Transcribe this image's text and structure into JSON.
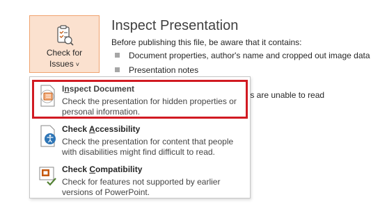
{
  "check_button": {
    "label_line1": "Check for",
    "label_line2": "Issues",
    "chevron": "˅",
    "icon": "checklist-icon"
  },
  "panel": {
    "title": "Inspect Presentation",
    "description": "Before publishing this file, be aware that it contains:",
    "bullets": [
      "Document properties, author's name and cropped out image data",
      "Presentation notes"
    ],
    "partial_text": "ies are unable to read"
  },
  "menu": {
    "items": [
      {
        "title_before": "I",
        "title_underline": "n",
        "title_after": "spect Document",
        "description": "Check the presentation for hidden properties or personal information.",
        "icon": "inspect-document-icon"
      },
      {
        "title_before": "Check ",
        "title_underline": "A",
        "title_after": "ccessibility",
        "description": "Check the presentation for content that people with disabilities might find difficult to read.",
        "icon": "accessibility-icon"
      },
      {
        "title_before": "Check ",
        "title_underline": "C",
        "title_after": "ompatibility",
        "description": "Check for features not supported by earlier versions of PowerPoint.",
        "icon": "compatibility-icon"
      }
    ]
  },
  "colors": {
    "highlight": "#d11a22",
    "button_bg": "#fbe1cf",
    "button_border": "#f0a36f"
  }
}
